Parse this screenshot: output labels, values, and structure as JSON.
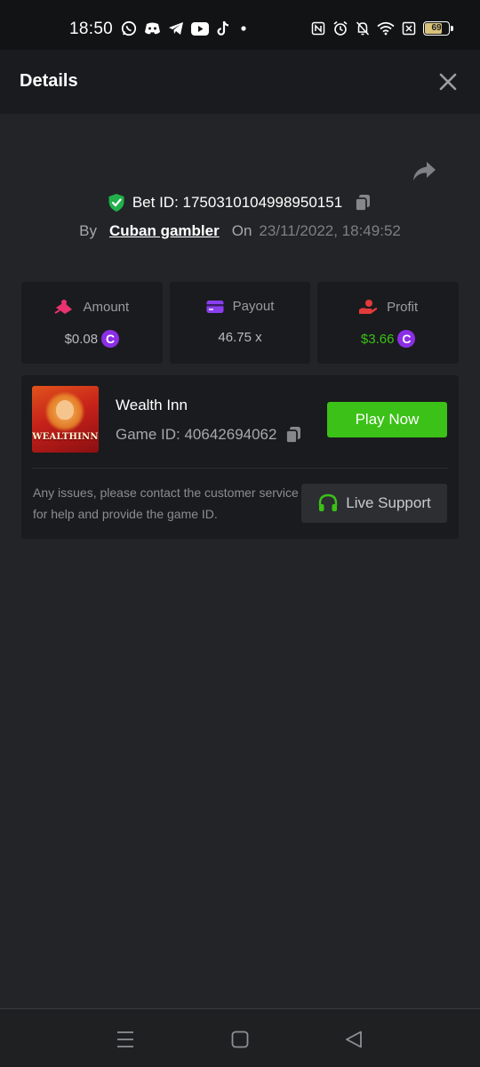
{
  "status_bar": {
    "time": "18:50",
    "app_icons": [
      "whatsapp-icon",
      "discord-icon",
      "telegram-icon",
      "youtube-icon",
      "tiktok-icon",
      "dot-icon"
    ],
    "system_icons": [
      "nfc-icon",
      "alarm-icon",
      "mute-bell-icon",
      "wifi-icon",
      "sim-off-icon"
    ],
    "battery_level": "69"
  },
  "header": {
    "title": "Details"
  },
  "bet": {
    "id_label": "Bet ID: 1750310104998950151",
    "by_label": "By",
    "username": "Cuban gambler",
    "on_label": "On",
    "date": "23/11/2022, 18:49:52"
  },
  "stats": {
    "amount": {
      "label": "Amount",
      "value": "$0.08",
      "coin": "C"
    },
    "payout": {
      "label": "Payout",
      "value": "46.75 x"
    },
    "profit": {
      "label": "Profit",
      "value": "$3.66",
      "coin": "C"
    }
  },
  "game": {
    "name": "Wealth Inn",
    "id_label": "Game ID: 40642694062",
    "thumb_title": "WEALTHINN",
    "play_label": "Play Now",
    "issue_text": "Any issues, please contact the customer service for help and provide the game ID.",
    "support_label": "Live Support"
  },
  "colors": {
    "accent_green": "#3bc117",
    "coin_purple": "#8c2ee6",
    "shield_green": "#21b04b",
    "amount_icon": "#e8336e",
    "payout_icon": "#8b3ef0",
    "profit_icon": "#e23b3b"
  }
}
